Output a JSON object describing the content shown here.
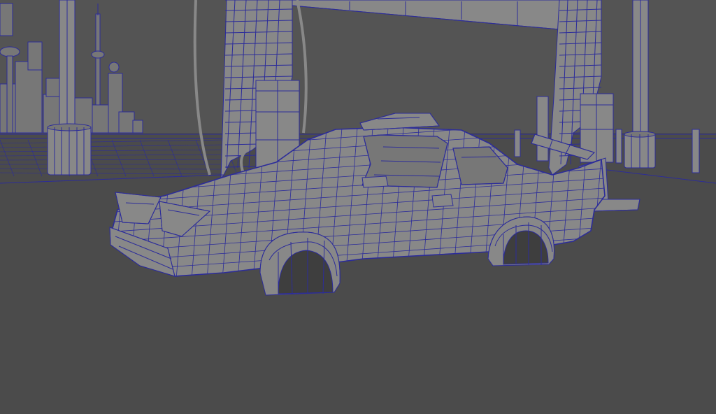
{
  "viewport": {
    "background_color": "#4a4a4a",
    "sky_color": "#545454",
    "ground_color": "#4b4b4b",
    "surface_color": "#888888",
    "surface_dark_color": "#777777",
    "wireframe_color": "#2c2c9a",
    "shading_mode": "wireframe-on-shaded"
  },
  "objects": [
    {
      "name": "city-skyline",
      "kind": "background-buildings"
    },
    {
      "name": "gas-station-canopy",
      "kind": "roof-with-pillars"
    },
    {
      "name": "fuel-pumps",
      "kind": "pump-boxes-with-hoses"
    },
    {
      "name": "fence-posts",
      "kind": "bollards"
    },
    {
      "name": "futuristic-car",
      "kind": "vehicle-mesh"
    }
  ]
}
